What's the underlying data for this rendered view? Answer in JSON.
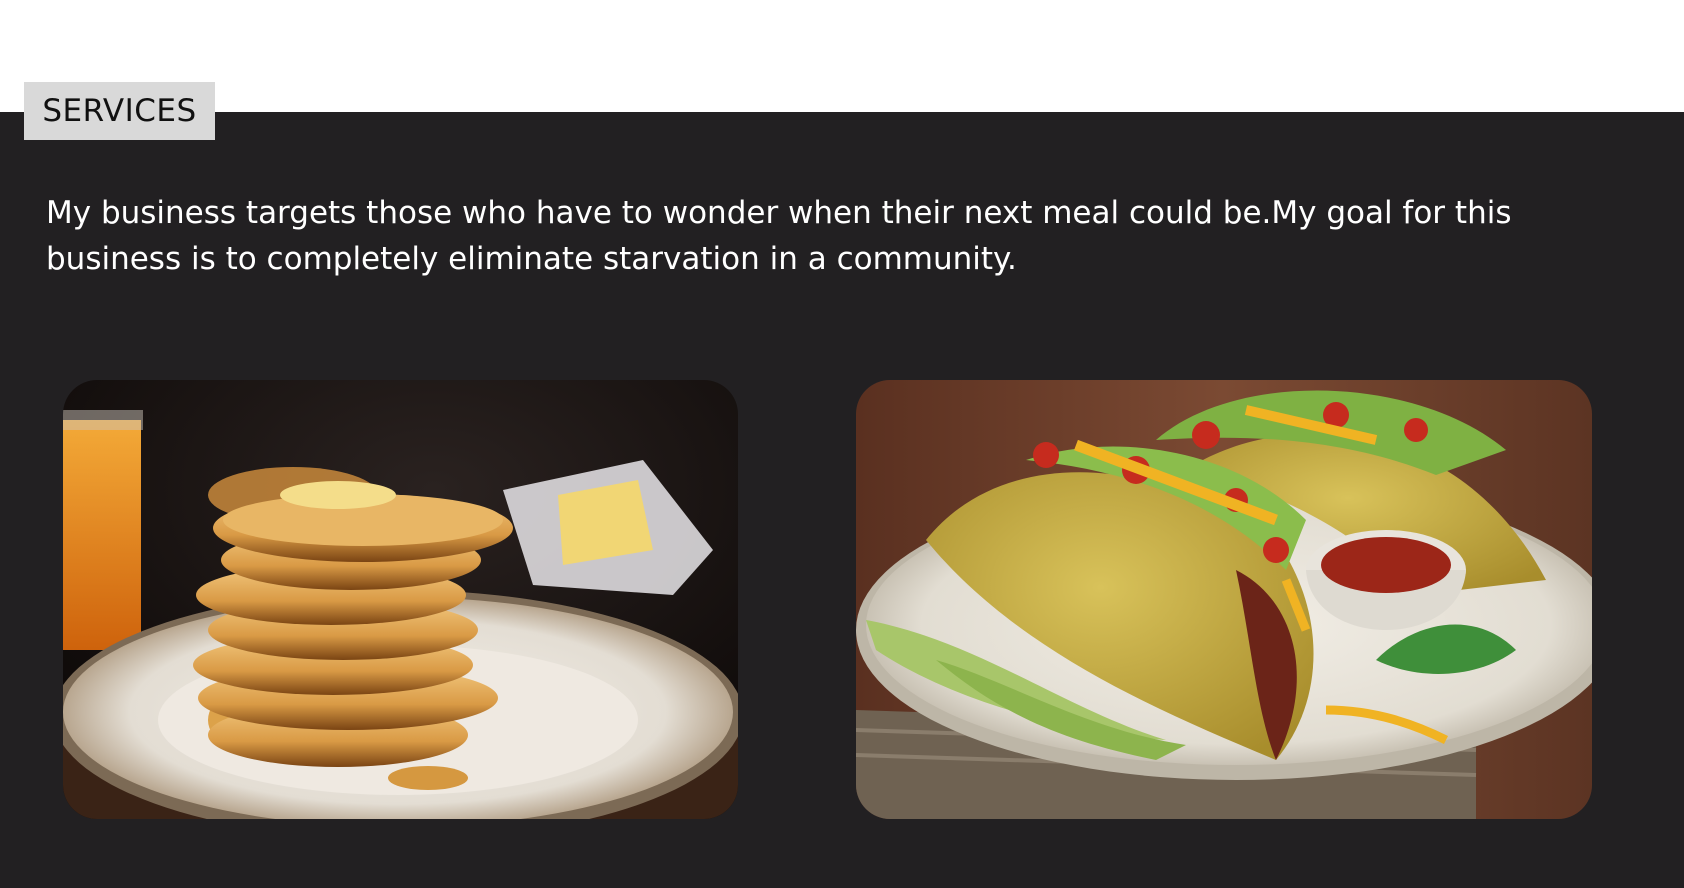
{
  "section": {
    "tag_label": "SERVICES",
    "description": "My business targets those who have to wonder when their next meal could be.My goal for this business is to completely eliminate starvation in a community."
  },
  "gallery": {
    "images": [
      {
        "subject": "stack of pancakes with butter and syrup on a plate"
      },
      {
        "subject": "hard-shell tacos with lettuce, tomato and cheese on a plate"
      }
    ]
  },
  "colors": {
    "background_dark": "#222022",
    "tag_background": "#d9d9d9",
    "text_light": "#ffffff"
  }
}
